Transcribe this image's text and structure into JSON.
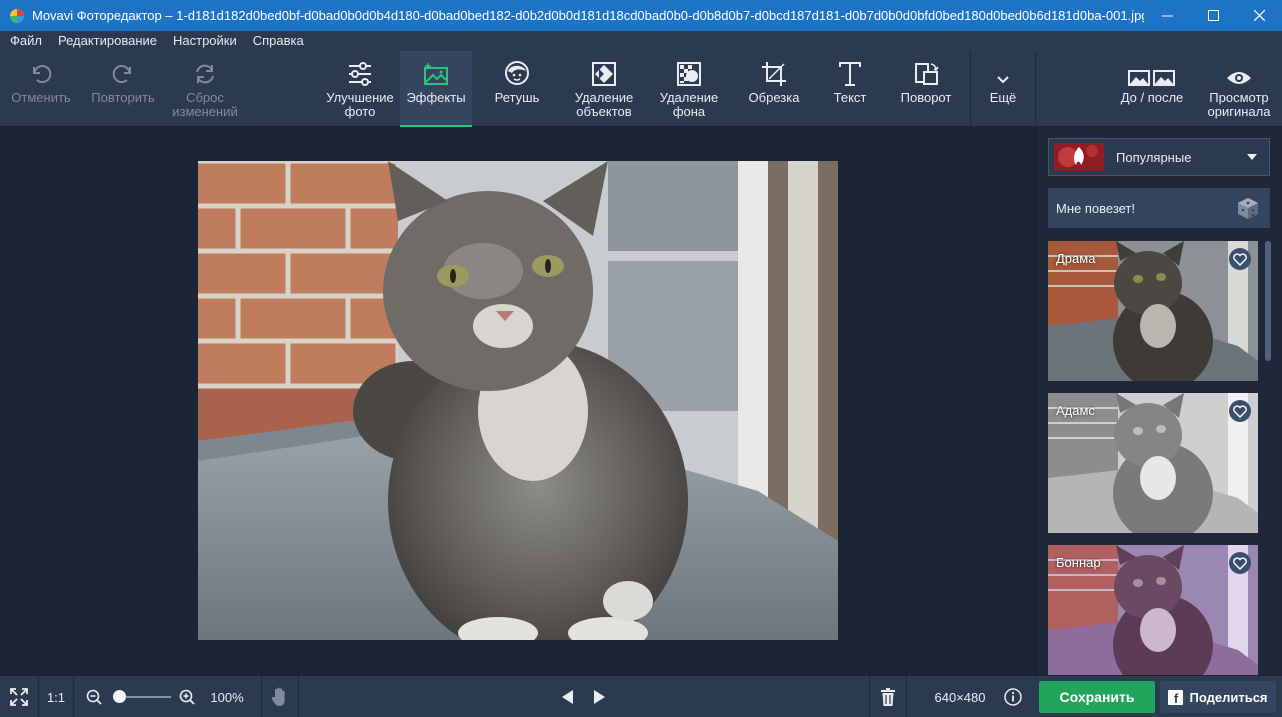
{
  "window": {
    "title": "Movavi Фоторедактор – 1-d181d182d0bed0bf-d0bad0b0d0b4d180-d0bad0bed182-d0b2d0b0d181d18cd0bad0b0-d0b8d0b7-d0bcd187d181-d0b7d0b0d0bfd0bed180d0bed0b6d181d0ba-001.jpg"
  },
  "menu": [
    "Файл",
    "Редактирование",
    "Настройки",
    "Справка"
  ],
  "toolbar": {
    "undo": "Отменить",
    "redo": "Повторить",
    "reset": "Сброс\nизменений",
    "enhance": "Улучшение\nфото",
    "effects": "Эффекты",
    "retouch": "Ретушь",
    "remove_objects": "Удаление\nобъектов",
    "remove_bg": "Удаление\nфона",
    "crop": "Обрезка",
    "text": "Текст",
    "rotate": "Поворот",
    "more": "Ещё",
    "before_after": "До / после",
    "view_original": "Просмотр\nоригинала"
  },
  "panel": {
    "category": "Популярные",
    "lucky": "Мне повезет!",
    "effects": [
      {
        "name": "Драма"
      },
      {
        "name": "Адамс"
      },
      {
        "name": "Боннар"
      }
    ]
  },
  "bottom": {
    "actual_size": "1:1",
    "zoom": "100%",
    "dimensions": "640×480",
    "save": "Сохранить",
    "share": "Поделиться"
  },
  "colors": {
    "accent": "#2ec27e",
    "save": "#22a45d",
    "titlebar": "#1f73c4"
  }
}
